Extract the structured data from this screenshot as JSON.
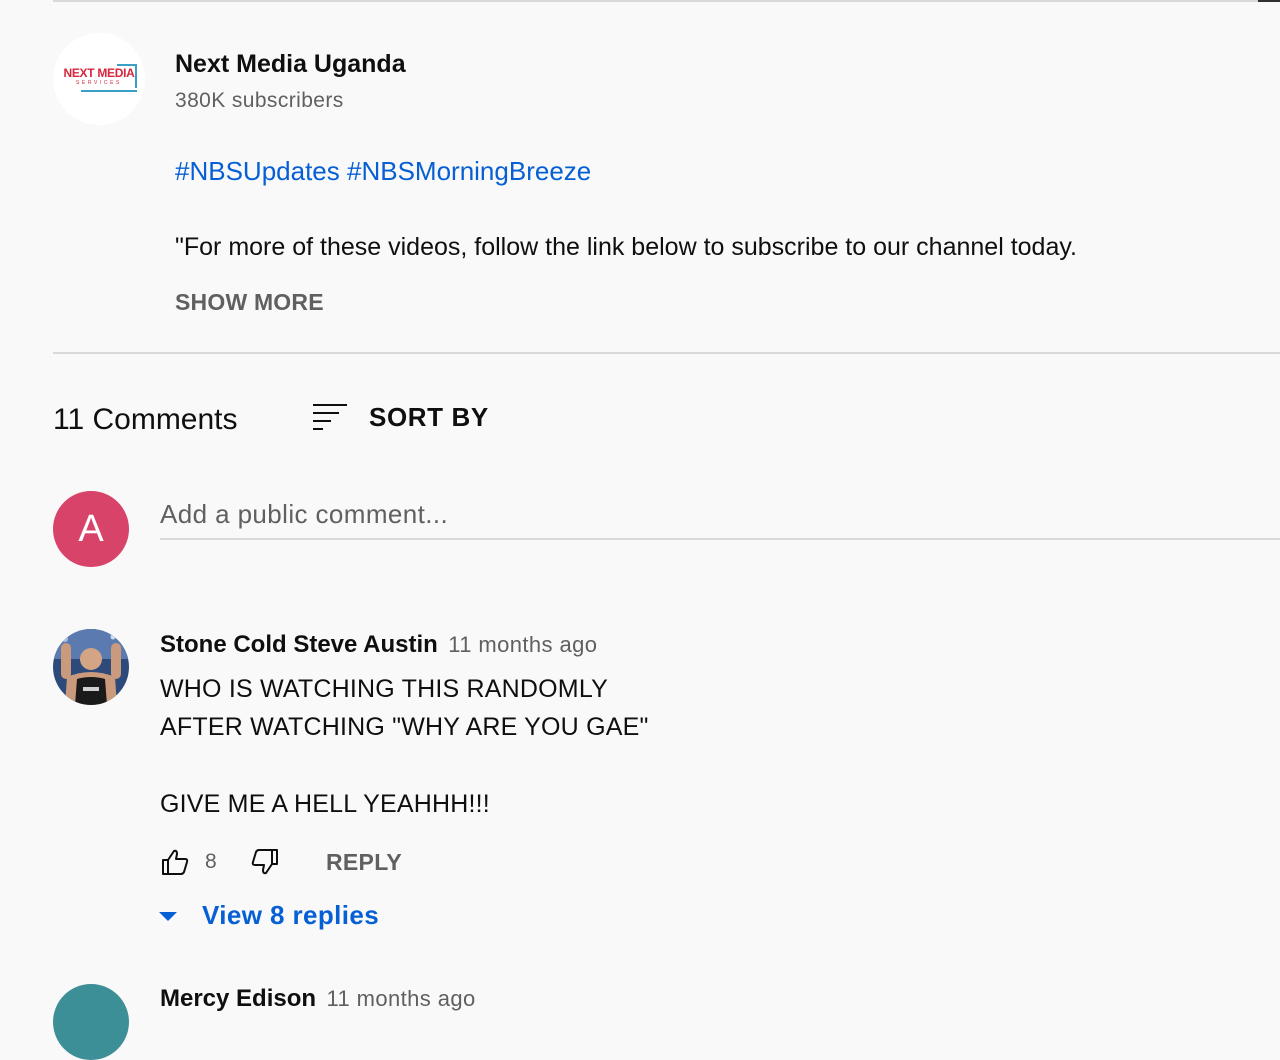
{
  "channel": {
    "logo_text": "NEXT MEDIA",
    "logo_subtext": "SERVICES",
    "name": "Next Media Uganda",
    "subscribers": "380K subscribers"
  },
  "description": {
    "hashtags": [
      "#NBSUpdates",
      "#NBSMorningBreeze"
    ],
    "text": "\"For more of these videos, follow the link below to subscribe to our channel today.",
    "show_more_label": "SHOW MORE"
  },
  "comments_header": {
    "count_label": "11 Comments",
    "sort_label": "SORT BY"
  },
  "add_comment": {
    "avatar_initial": "A",
    "placeholder": "Add a public comment..."
  },
  "comments": [
    {
      "author": "Stone Cold Steve Austin",
      "time": "11 months ago",
      "lines": [
        "WHO IS WATCHING THIS RANDOMLY",
        "AFTER WATCHING \"WHY ARE YOU GAE\"",
        "",
        "GIVE ME A HELL YEAHHH!!!"
      ],
      "likes": "8",
      "reply_label": "REPLY",
      "view_replies_label": "View 8 replies"
    },
    {
      "author": "Mercy Edison",
      "time": "11 months ago"
    }
  ],
  "icons": {
    "sort": "sort-icon",
    "like": "thumbs-up-icon",
    "dislike": "thumbs-down-icon",
    "expand": "caret-down-icon"
  },
  "colors": {
    "background": "#f9f9f9",
    "link": "#065fd4",
    "secondary_text": "#606060",
    "user_avatar": "#d8436a",
    "next_avatar": "#3c8f96"
  }
}
